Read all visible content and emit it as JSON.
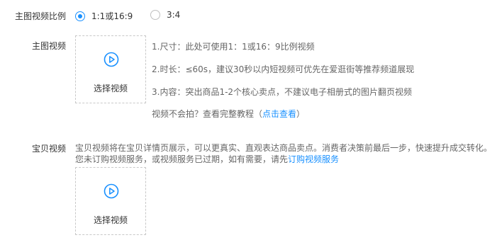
{
  "aspect_ratio": {
    "label": "主图视频比例",
    "options": [
      {
        "label": "1:1或16:9",
        "selected": true
      },
      {
        "label": "3:4",
        "selected": false
      }
    ]
  },
  "main_video": {
    "label": "主图视频",
    "upload_label": "选择视频",
    "upload_icon": "play-circle-icon",
    "tips": [
      "1.尺寸：此处可使用1：1或16：9比例视频",
      "2.时长：≤60s，建议30秒以内短视频可优先在爱逛街等推荐频道展现",
      "3.内容：突出商品1-2个核心卖点，不建议电子相册式的图片翻页视频"
    ],
    "tutorial_prefix": "视频不会拍？查看完整教程（",
    "tutorial_link": "点击查看",
    "tutorial_suffix": "）"
  },
  "detail_video": {
    "label": "宝贝视频",
    "description": "宝贝视频将在宝贝详情页展示，可以更真实、直观表达商品卖点。消费者决策前最后一步，快速提升成交转化。",
    "notice_prefix": "您未订购视频服务，或视频服务已过期，如有需要，请先",
    "notice_link": "订购视频服务",
    "upload_label": "选择视频",
    "upload_icon": "play-circle-icon"
  },
  "colors": {
    "accent": "#1890ff",
    "text": "#333333",
    "muted": "#666666",
    "border": "#c8c8c8"
  }
}
